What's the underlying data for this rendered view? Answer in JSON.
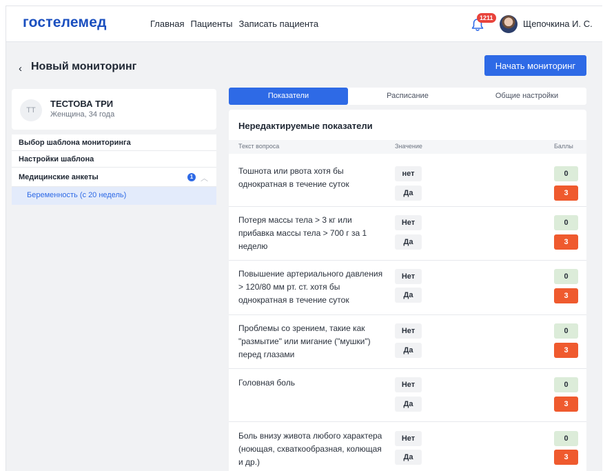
{
  "header": {
    "logo": "гостелемед",
    "nav": [
      "Главная",
      "Пациенты",
      "Записать пациента"
    ],
    "notifications_count": "1211",
    "user_name": "Щепочкина И. С."
  },
  "page": {
    "back_symbol": "‹",
    "title": "Новый мониторинг",
    "start_button": "Начать мониторинг"
  },
  "patient": {
    "initials": "ТТ",
    "name": "ТЕСТОВА ТРИ",
    "details": "Женщина, 34 года"
  },
  "left_menu": {
    "template_choice": "Выбор шаблона мониторинга",
    "template_settings": "Настройки шаблона",
    "medical_forms": "Медицинские анкеты",
    "medical_forms_count": "1",
    "sub_item": "Беременность (с 20 недель)"
  },
  "tabs": [
    "Показатели",
    "Расписание",
    "Общие настройки"
  ],
  "panel": {
    "title": "Нередактируемые показатели",
    "columns": {
      "question": "Текст вопроса",
      "value": "Значение",
      "score": "Баллы"
    },
    "rows": [
      {
        "question": "Тошнота или рвота хотя бы однократная в течение суток",
        "answers": [
          "нет",
          "Да"
        ],
        "scores": [
          "0",
          "3"
        ]
      },
      {
        "question": "Потеря массы тела > 3 кг или прибавка массы тела > 700 г за 1 неделю",
        "answers": [
          "Нет",
          "Да"
        ],
        "scores": [
          "0",
          "3"
        ]
      },
      {
        "question": "Повышение артериального давления > 120/80 мм рт. ст. хотя бы однократная в течение суток",
        "answers": [
          "Нет",
          "Да"
        ],
        "scores": [
          "0",
          "3"
        ]
      },
      {
        "question": "Проблемы со зрением, такие как \"размытие\" или мигание (\"мушки\") перед глазами",
        "answers": [
          "Нет",
          "Да"
        ],
        "scores": [
          "0",
          "3"
        ]
      },
      {
        "question": "Головная боль",
        "answers": [
          "Нет",
          "Да"
        ],
        "scores": [
          "0",
          "3"
        ]
      },
      {
        "question": "Боль внизу живота любого характера (ноющая, схваткообразная, колющая и др.)",
        "answers": [
          "Нет",
          "Да"
        ],
        "scores": [
          "0",
          "3"
        ]
      }
    ]
  },
  "colors": {
    "brand": "#1a4fbf",
    "accent": "#2e6ae6",
    "score_zero_bg": "#dcecd9",
    "score_three_bg": "#ef5a2e",
    "badge": "#e8433c"
  },
  "icons": {
    "notifications": "bell-icon",
    "back": "chevron-left-icon",
    "collapse": "chevron-up-icon"
  }
}
